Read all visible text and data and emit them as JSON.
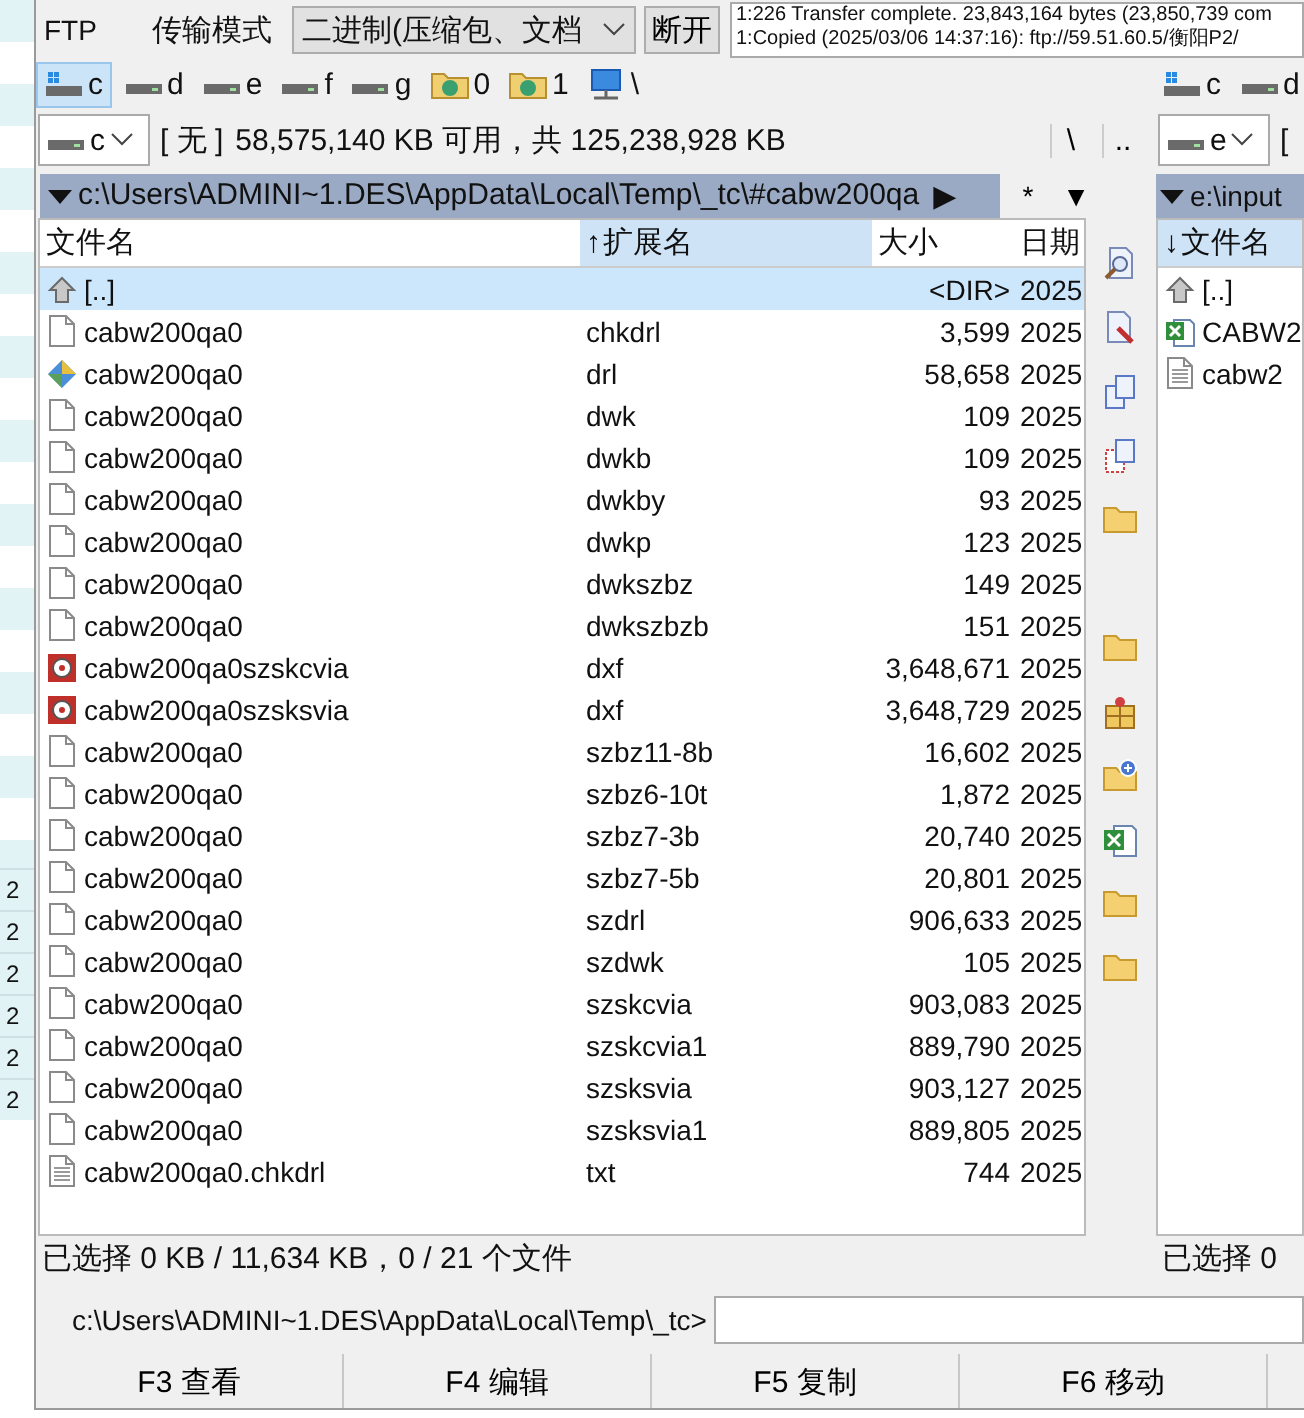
{
  "background_window": {
    "row_labels": [
      "2",
      "2",
      "2",
      "2",
      "2",
      "2"
    ]
  },
  "toolbar": {
    "ftp_label": "FTP",
    "mode_label": "传输模式",
    "mode_dropdown": "二进制(压缩包、文档",
    "disconnect_button": "断开",
    "log": [
      "1:226 Transfer complete. 23,843,164 bytes (23,850,739 com",
      "1:Copied (2025/03/06 14:37:16): ftp://59.51.60.5/衡阳P2/"
    ]
  },
  "left_panel": {
    "drives": [
      {
        "label": "c",
        "kind": "system",
        "selected": true
      },
      {
        "label": "d",
        "kind": "hdd",
        "selected": false
      },
      {
        "label": "e",
        "kind": "hdd",
        "selected": false
      },
      {
        "label": "f",
        "kind": "hdd",
        "selected": false
      },
      {
        "label": "g",
        "kind": "hdd",
        "selected": false
      },
      {
        "label": "0",
        "kind": "share",
        "selected": false
      },
      {
        "label": "1",
        "kind": "share",
        "selected": false
      },
      {
        "label": "\\",
        "kind": "network",
        "selected": false
      }
    ],
    "drive_combo": "c",
    "volume_label": "[ 无 ]",
    "free_space": "58,575,140 KB 可用，共 125,238,928 KB",
    "root_button": "\\",
    "parent_button": "..",
    "path": "c:\\Users\\ADMINI~1.DES\\AppData\\Local\\Temp\\_tc\\#cabw200qa",
    "path_arrow": "▶",
    "filter": "*",
    "filter_arrow": "▼",
    "columns": [
      {
        "label": "文件名"
      },
      {
        "label": "扩展名",
        "sort_arrow": "↑"
      },
      {
        "label": "大小"
      },
      {
        "label": "日期"
      }
    ],
    "rows": [
      {
        "name": "[..]",
        "size": "<DIR>",
        "date": "2025",
        "kind": "up",
        "selected": true
      },
      {
        "name": "cabw200qa0",
        "ext": "chkdrl",
        "size": "3,599",
        "date": "2025",
        "kind": "file",
        "selected": false
      },
      {
        "name": "cabw200qa0",
        "ext": "drl",
        "size": "58,658",
        "date": "2025",
        "kind": "drl",
        "selected": false
      },
      {
        "name": "cabw200qa0",
        "ext": "dwk",
        "size": "109",
        "date": "2025",
        "kind": "file",
        "selected": false
      },
      {
        "name": "cabw200qa0",
        "ext": "dwkb",
        "size": "109",
        "date": "2025",
        "kind": "file",
        "selected": false
      },
      {
        "name": "cabw200qa0",
        "ext": "dwkby",
        "size": "93",
        "date": "2025",
        "kind": "file",
        "selected": false
      },
      {
        "name": "cabw200qa0",
        "ext": "dwkp",
        "size": "123",
        "date": "2025",
        "kind": "file",
        "selected": false
      },
      {
        "name": "cabw200qa0",
        "ext": "dwkszbz",
        "size": "149",
        "date": "2025",
        "kind": "file",
        "selected": false
      },
      {
        "name": "cabw200qa0",
        "ext": "dwkszbzb",
        "size": "151",
        "date": "2025",
        "kind": "file",
        "selected": false
      },
      {
        "name": "cabw200qa0szskcvia",
        "ext": "dxf",
        "size": "3,648,671",
        "date": "2025",
        "kind": "dxf",
        "selected": false
      },
      {
        "name": "cabw200qa0szsksvia",
        "ext": "dxf",
        "size": "3,648,729",
        "date": "2025",
        "kind": "dxf",
        "selected": false
      },
      {
        "name": "cabw200qa0",
        "ext": "szbz11-8b",
        "size": "16,602",
        "date": "2025",
        "kind": "file",
        "selected": false
      },
      {
        "name": "cabw200qa0",
        "ext": "szbz6-10t",
        "size": "1,872",
        "date": "2025",
        "kind": "file",
        "selected": false
      },
      {
        "name": "cabw200qa0",
        "ext": "szbz7-3b",
        "size": "20,740",
        "date": "2025",
        "kind": "file",
        "selected": false
      },
      {
        "name": "cabw200qa0",
        "ext": "szbz7-5b",
        "size": "20,801",
        "date": "2025",
        "kind": "file",
        "selected": false
      },
      {
        "name": "cabw200qa0",
        "ext": "szdrl",
        "size": "906,633",
        "date": "2025",
        "kind": "file",
        "selected": false
      },
      {
        "name": "cabw200qa0",
        "ext": "szdwk",
        "size": "105",
        "date": "2025",
        "kind": "file",
        "selected": false
      },
      {
        "name": "cabw200qa0",
        "ext": "szskcvia",
        "size": "903,083",
        "date": "2025",
        "kind": "file",
        "selected": false
      },
      {
        "name": "cabw200qa0",
        "ext": "szskcvia1",
        "size": "889,790",
        "date": "2025",
        "kind": "file",
        "selected": false
      },
      {
        "name": "cabw200qa0",
        "ext": "szsksvia",
        "size": "903,127",
        "date": "2025",
        "kind": "file",
        "selected": false
      },
      {
        "name": "cabw200qa0",
        "ext": "szsksvia1",
        "size": "889,805",
        "date": "2025",
        "kind": "file",
        "selected": false
      },
      {
        "name": "cabw200qa0.chkdrl",
        "ext": "txt",
        "size": "744",
        "date": "2025",
        "kind": "txt",
        "selected": false
      }
    ],
    "status": "已选择 0 KB / 11,634 KB，0 / 21 个文件"
  },
  "middle_toolbar": [
    {
      "kind": "view"
    },
    {
      "kind": "edit"
    },
    {
      "kind": "copy"
    },
    {
      "kind": "copy-dashed"
    },
    {
      "kind": "folder"
    },
    {
      "kind": "gap"
    },
    {
      "kind": "folder"
    },
    {
      "kind": "package"
    },
    {
      "kind": "folder-new"
    },
    {
      "kind": "excel"
    },
    {
      "kind": "folder"
    },
    {
      "kind": "folder"
    }
  ],
  "right_panel": {
    "drives": [
      {
        "label": "c",
        "kind": "system",
        "selected": false
      },
      {
        "label": "d",
        "kind": "hdd",
        "selected": false
      }
    ],
    "drive_combo": "e",
    "volume_label": "[",
    "path": "e:\\input",
    "columns": [
      {
        "label": "文件名",
        "sort_arrow": "↓"
      }
    ],
    "rows": [
      {
        "name": "[..]",
        "kind": "up",
        "selected": false
      },
      {
        "name": "CABW2",
        "kind": "excel",
        "selected": false
      },
      {
        "name": "cabw2",
        "kind": "txt",
        "selected": false
      }
    ],
    "status": "已选择 0"
  },
  "command_line": {
    "prompt": "c:\\Users\\ADMINI~1.DES\\AppData\\Local\\Temp\\_tc>"
  },
  "function_keys": [
    "F3 查看",
    "F4 编辑",
    "F5 复制",
    "F6 移动"
  ]
}
